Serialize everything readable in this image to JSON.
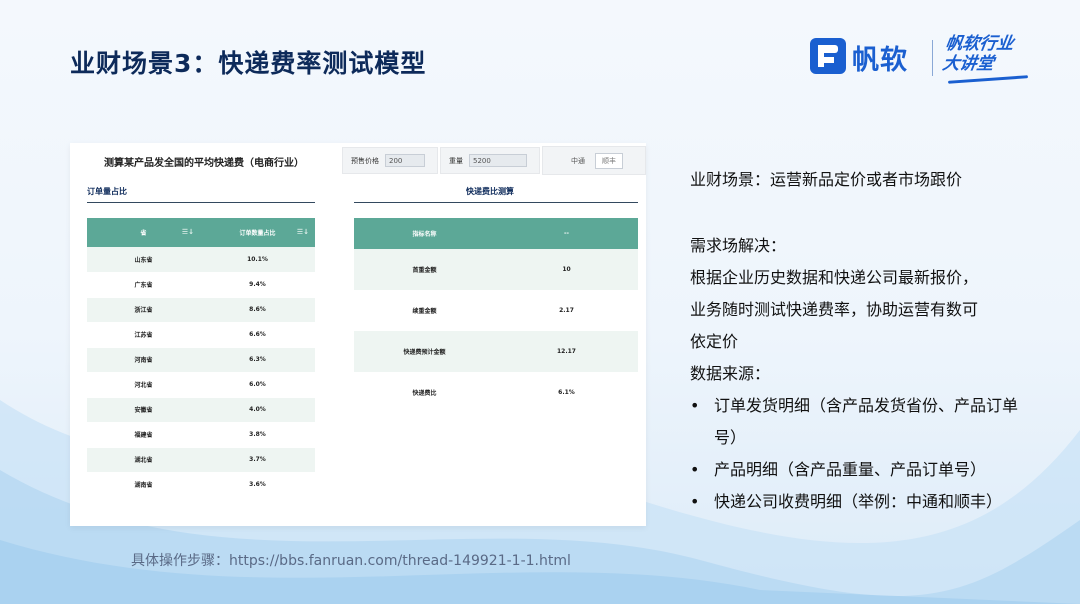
{
  "slide": {
    "title": "业财场景3：快递费率测试模型",
    "footer": "具体操作步骤：https://bbs.fanruan.com/thread-149921-1-1.html"
  },
  "brand": {
    "name": "帆软",
    "badge_line1": "帆软行业",
    "badge_line2": "大讲堂",
    "color": "#1a5fd0"
  },
  "report": {
    "title": "测算某产品发全国的平均快递费（电商行业）",
    "params": {
      "price_label": "预售价格",
      "price_value": "200",
      "weight_label": "重量",
      "weight_value": "5200",
      "carrier_options": [
        "中通",
        "顺丰"
      ],
      "carrier_selected": "顺丰"
    },
    "order_share": {
      "section": "订单量占比",
      "headers": [
        "省",
        "订单数量占比"
      ],
      "rows": [
        [
          "山东省",
          "10.1%"
        ],
        [
          "广东省",
          "9.4%"
        ],
        [
          "浙江省",
          "8.6%"
        ],
        [
          "江苏省",
          "6.6%"
        ],
        [
          "河南省",
          "6.3%"
        ],
        [
          "河北省",
          "6.0%"
        ],
        [
          "安徽省",
          "4.0%"
        ],
        [
          "福建省",
          "3.8%"
        ],
        [
          "湖北省",
          "3.7%"
        ],
        [
          "湖南省",
          "3.6%"
        ]
      ]
    },
    "fee_calc": {
      "section": "快递费比测算",
      "headers": [
        "指标名称",
        "--"
      ],
      "rows": [
        [
          "首重金额",
          "10"
        ],
        [
          "续重金额",
          "2.17"
        ],
        [
          "快递费预计金额",
          "12.17"
        ],
        [
          "快递费比",
          "6.1%"
        ]
      ]
    },
    "header_color": "#5ca897"
  },
  "description": {
    "scene": "业财场景：运营新品定价或者市场跟价",
    "need_title": "需求场解决：",
    "need_lines": [
      "根据企业历史数据和快递公司最新报价，",
      "业务随时测试快递费率，协助运营有数可",
      "依定价"
    ],
    "source_title": "数据来源：",
    "sources": [
      "订单发货明细（含产品发货省份、产品订单号）",
      "产品明细（含产品重量、产品订单号）",
      "快递公司收费明细（举例：中通和顺丰）"
    ]
  }
}
